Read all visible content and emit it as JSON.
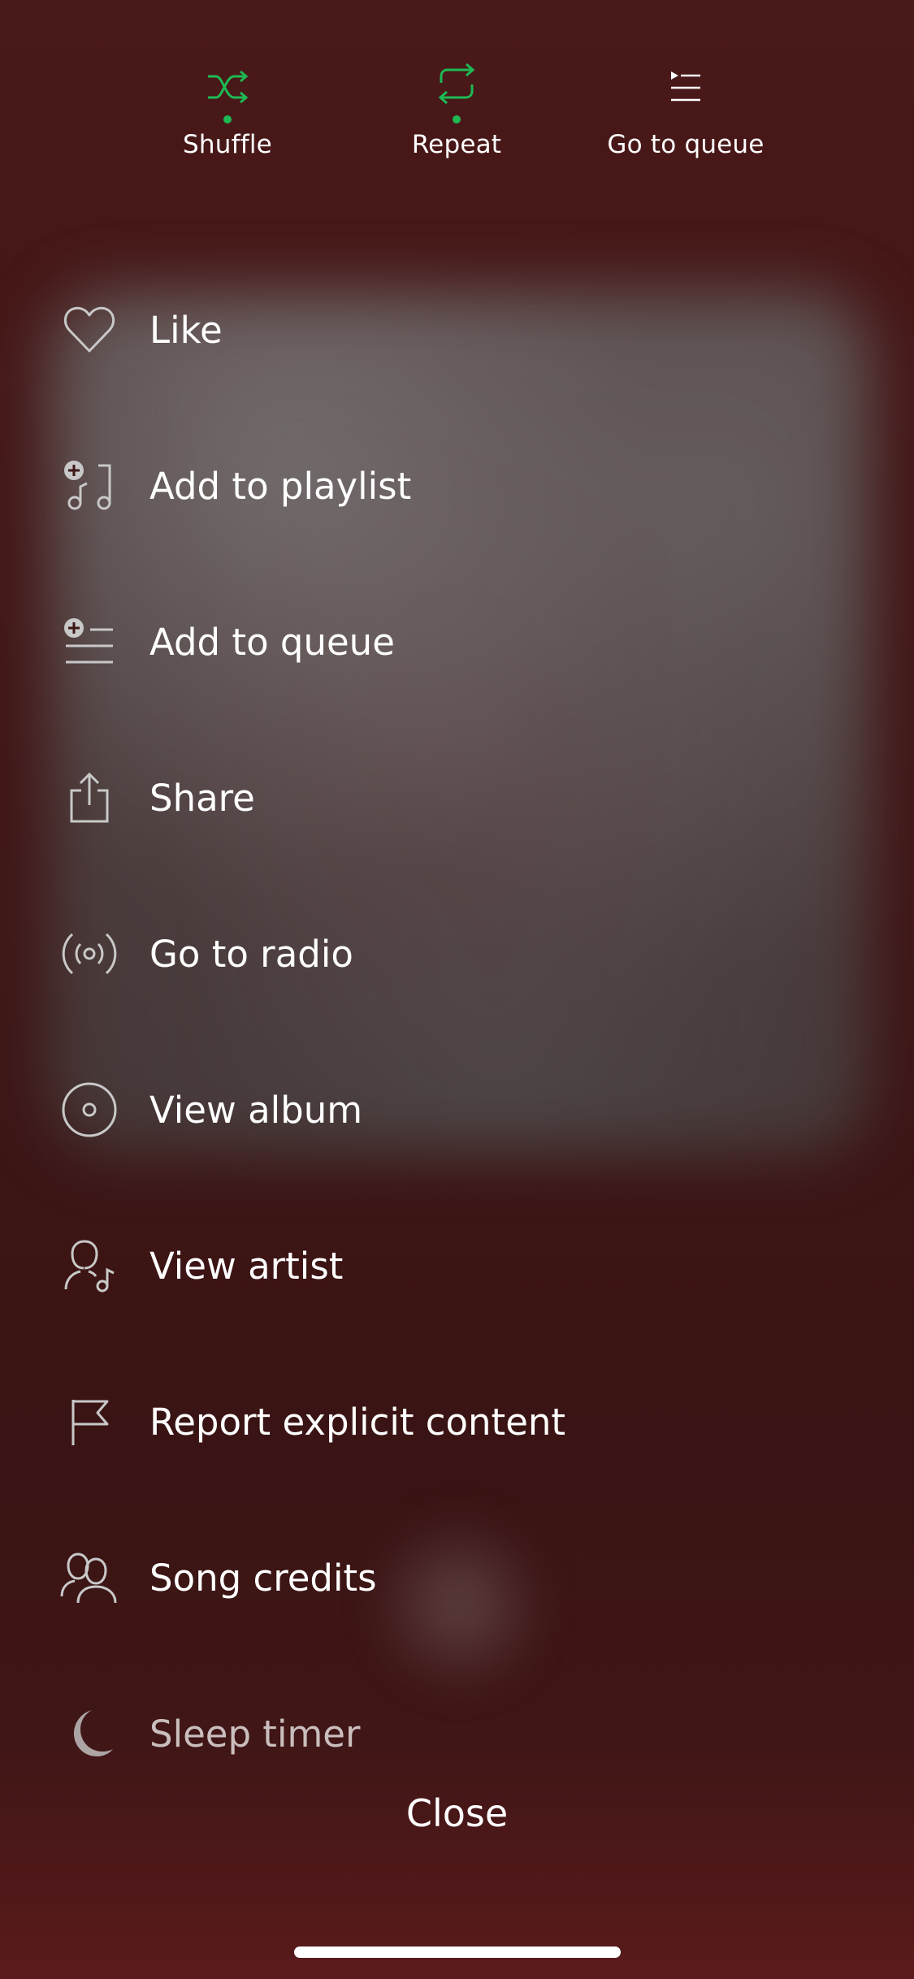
{
  "top_controls": {
    "shuffle": {
      "label": "Shuffle",
      "icon": "shuffle-icon",
      "active": true
    },
    "repeat": {
      "label": "Repeat",
      "icon": "repeat-icon",
      "active": true
    },
    "queue": {
      "label": "Go to queue",
      "icon": "queue-icon",
      "active": false
    }
  },
  "menu": {
    "items": [
      {
        "label": "Like",
        "icon": "heart-icon"
      },
      {
        "label": "Add to playlist",
        "icon": "add-to-playlist-icon"
      },
      {
        "label": "Add to queue",
        "icon": "add-to-queue-icon"
      },
      {
        "label": "Share",
        "icon": "share-icon"
      },
      {
        "label": "Go to radio",
        "icon": "radio-icon"
      },
      {
        "label": "View album",
        "icon": "album-icon"
      },
      {
        "label": "View artist",
        "icon": "artist-icon"
      },
      {
        "label": "Report explicit content",
        "icon": "flag-icon"
      },
      {
        "label": "Song credits",
        "icon": "credits-icon"
      },
      {
        "label": "Sleep timer",
        "icon": "moon-icon"
      }
    ]
  },
  "close_label": "Close",
  "colors": {
    "accent_green": "#1db954",
    "background": "#431616",
    "icon_gray": "#c8c8c8"
  }
}
